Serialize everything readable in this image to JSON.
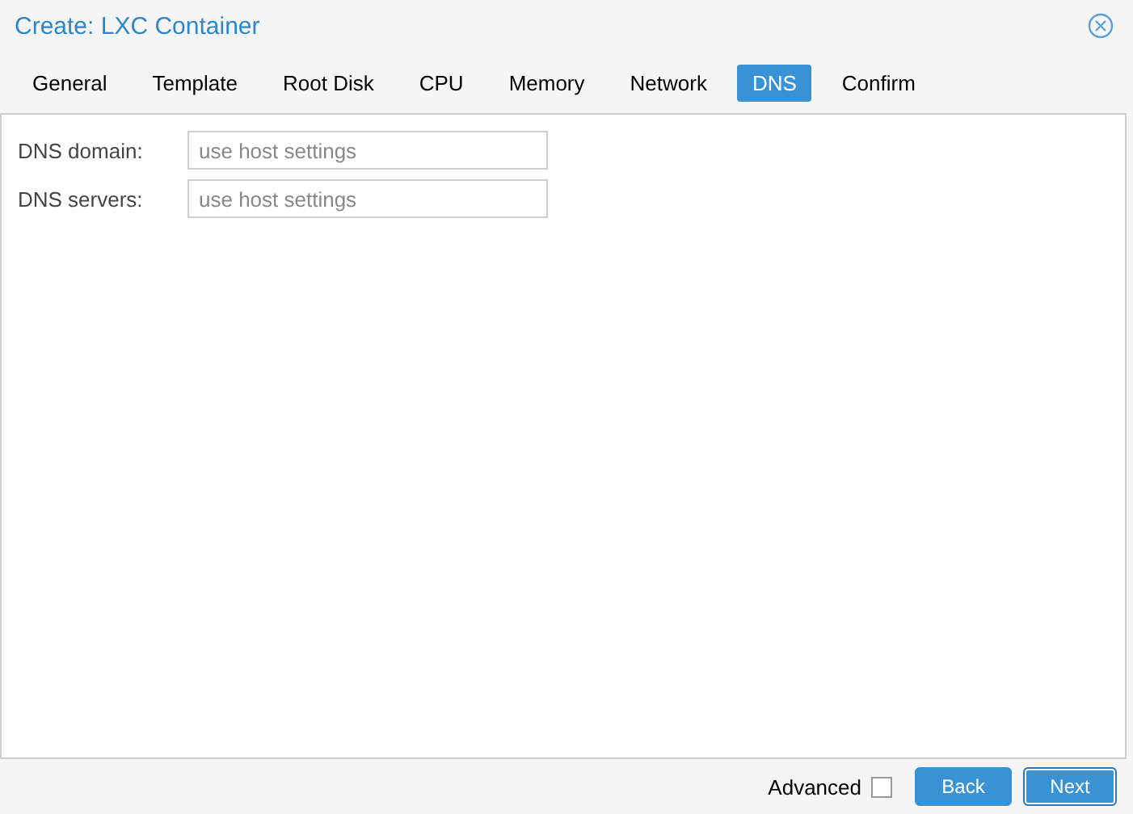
{
  "window": {
    "title": "Create: LXC Container"
  },
  "tabs": [
    {
      "label": "General",
      "selected": false
    },
    {
      "label": "Template",
      "selected": false
    },
    {
      "label": "Root Disk",
      "selected": false
    },
    {
      "label": "CPU",
      "selected": false
    },
    {
      "label": "Memory",
      "selected": false
    },
    {
      "label": "Network",
      "selected": false
    },
    {
      "label": "DNS",
      "selected": true
    },
    {
      "label": "Confirm",
      "selected": false
    }
  ],
  "fields": [
    {
      "label": "DNS domain:",
      "placeholder": "use host settings"
    },
    {
      "label": "DNS servers:",
      "placeholder": "use host settings"
    }
  ],
  "footer": {
    "advanced": {
      "label": "Advanced",
      "checked": false
    },
    "buttons": [
      {
        "label": "Back",
        "kind": "normal"
      },
      {
        "label": "Next",
        "kind": "focused"
      }
    ]
  }
}
